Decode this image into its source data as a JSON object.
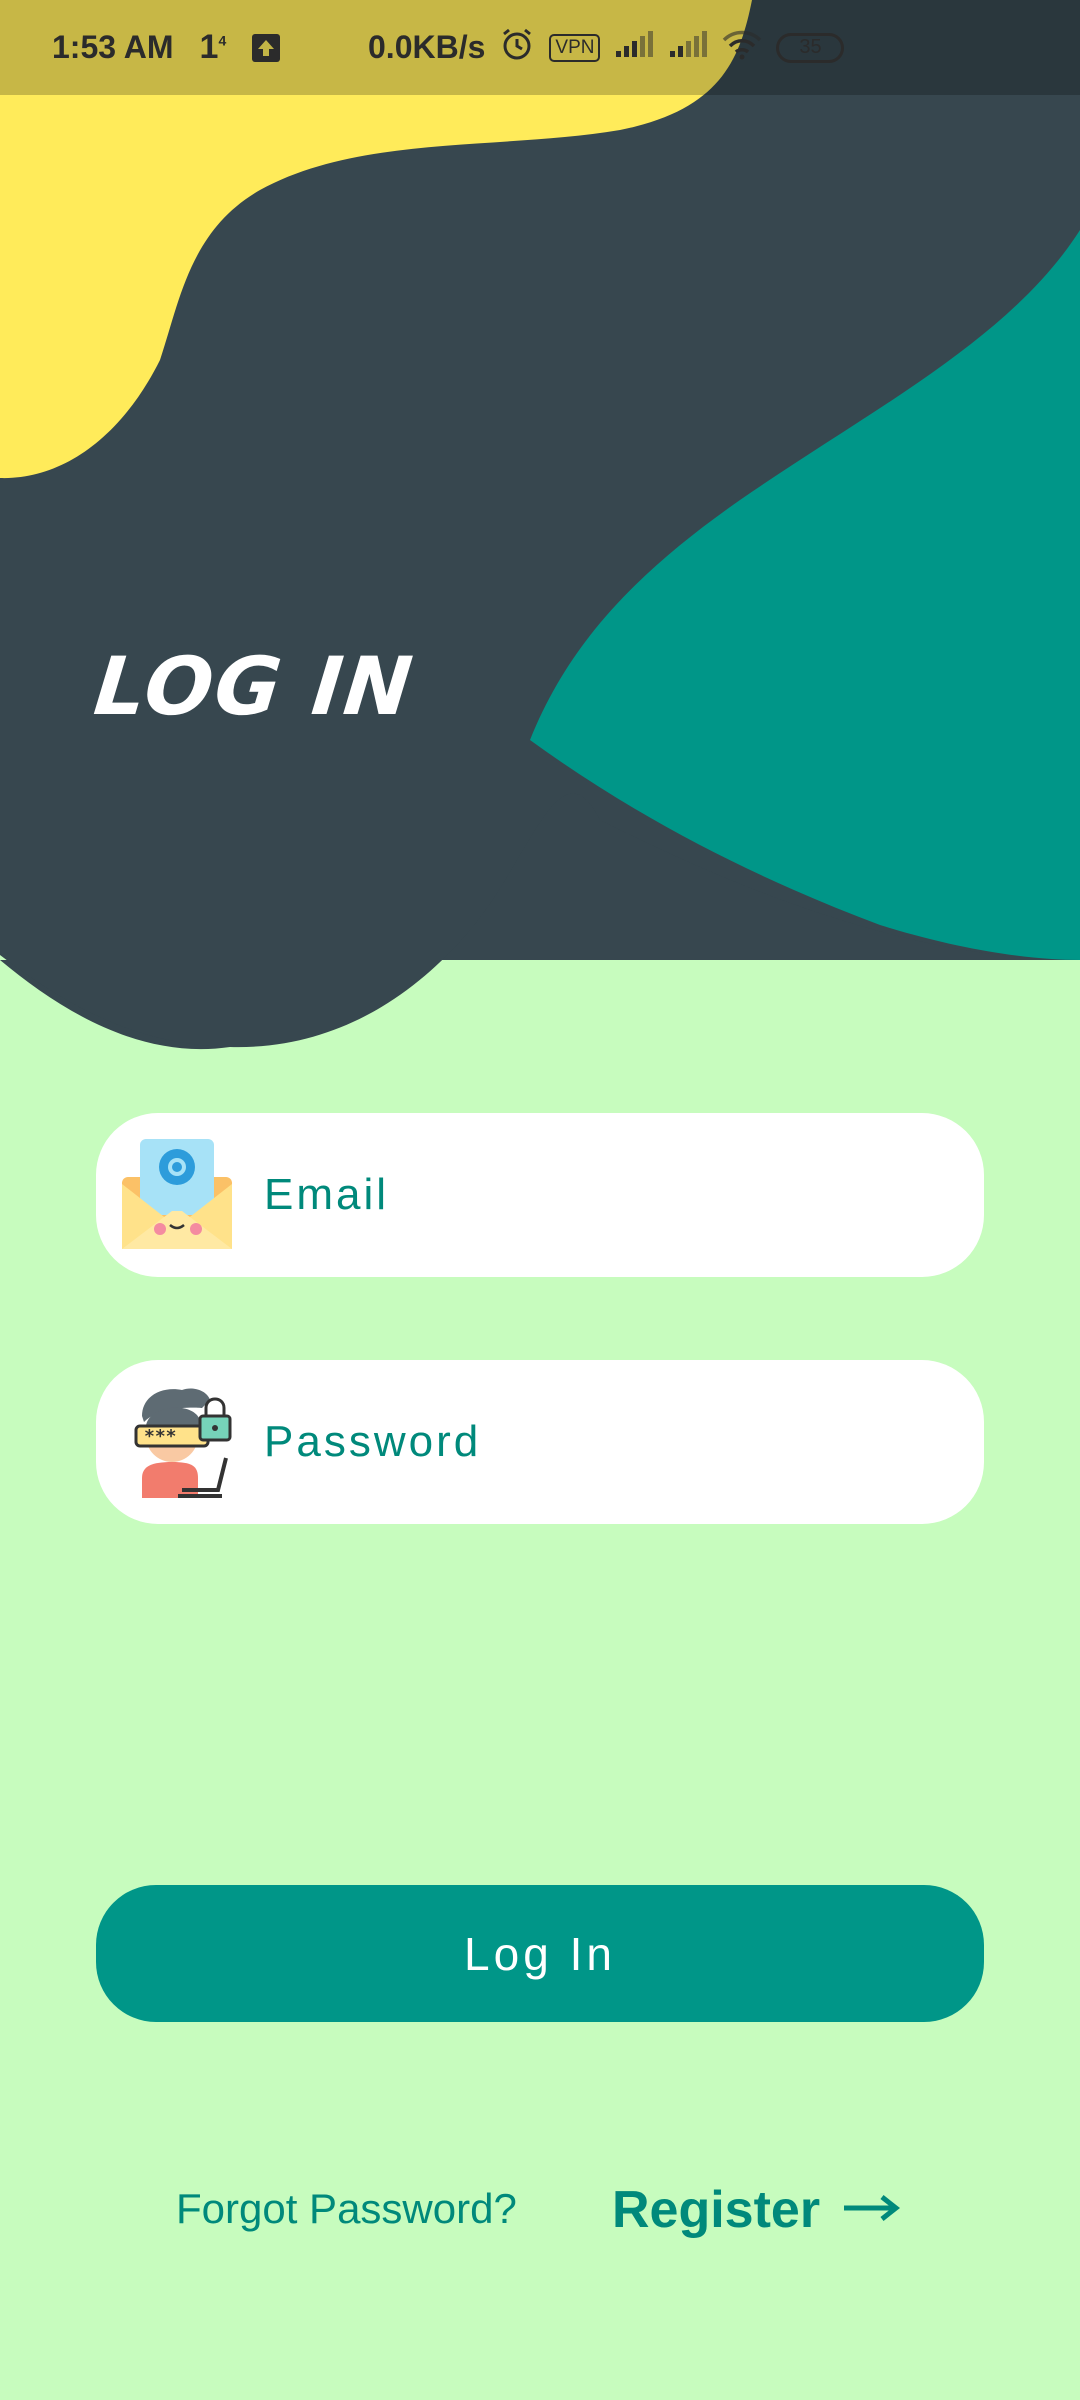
{
  "status_bar": {
    "time": "1:53 AM",
    "indicator": "1",
    "indicator_sup": "4",
    "net_speed": "0.0KB/s",
    "vpn": "VPN",
    "battery": "35"
  },
  "header": {
    "title": "LOG IN"
  },
  "form": {
    "email_placeholder": "Email",
    "password_placeholder": "Password",
    "login_label": "Log In"
  },
  "footer": {
    "forgot_label": "Forgot Password?",
    "register_label": "Register"
  },
  "colors": {
    "background": "#C7FCBE",
    "dark_blob": "#37474F",
    "teal_blob": "#009688",
    "yellow_blob": "#FFEB5A",
    "accent_text": "#00897B",
    "button": "#009688"
  },
  "icons": {
    "email": "envelope-at-icon",
    "password": "user-password-icon",
    "register_arrow": "arrow-right-icon"
  }
}
